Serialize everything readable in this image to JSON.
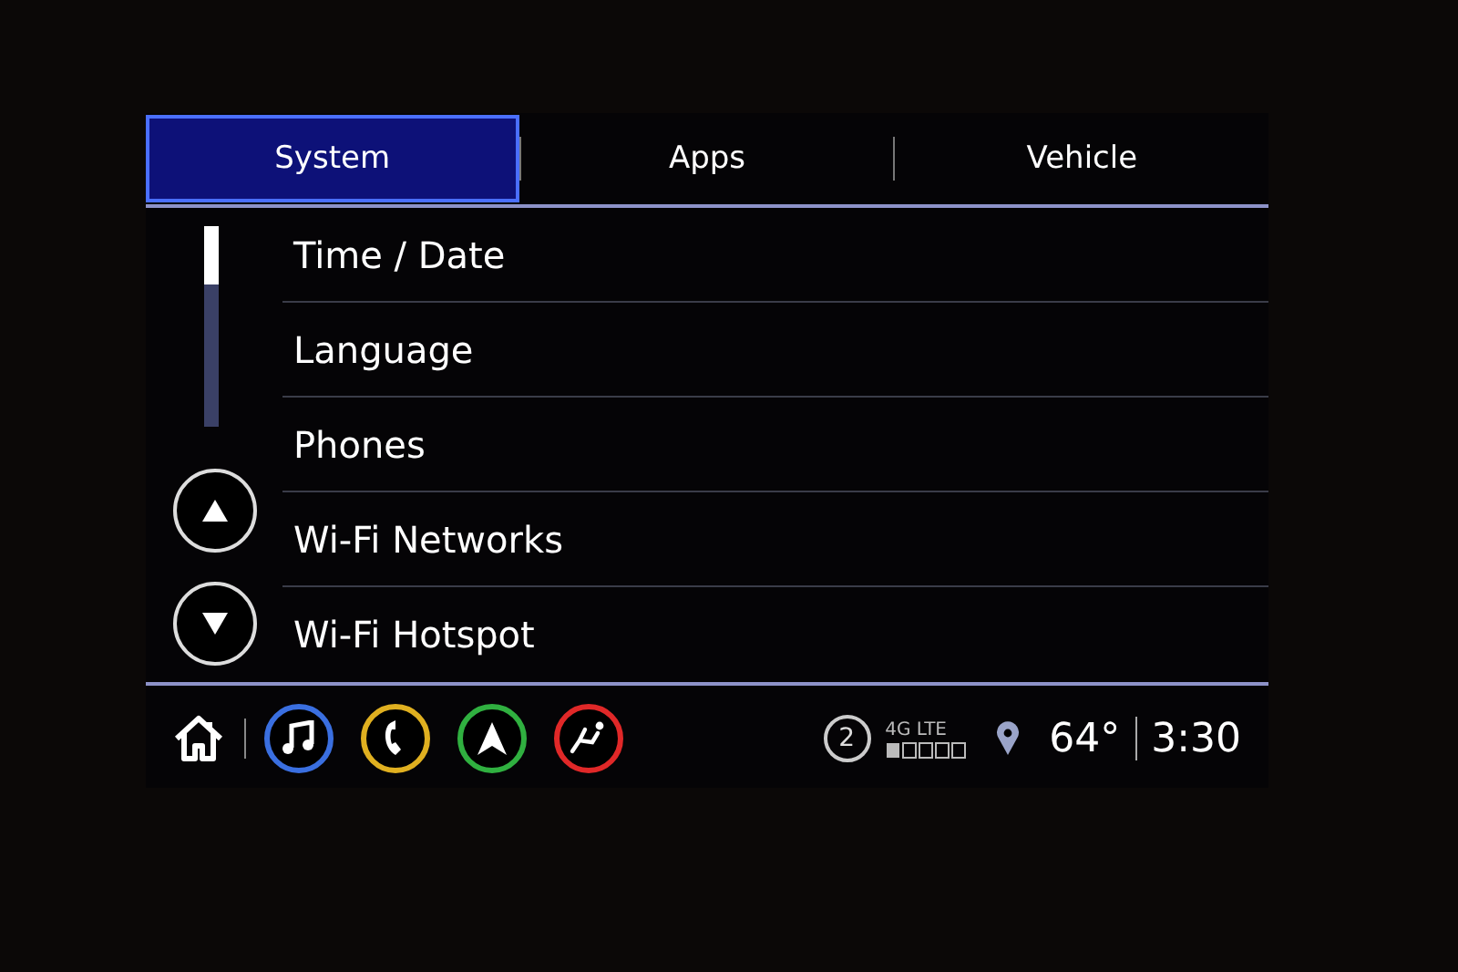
{
  "tabs": [
    {
      "label": "System",
      "selected": true
    },
    {
      "label": "Apps",
      "selected": false
    },
    {
      "label": "Vehicle",
      "selected": false
    }
  ],
  "menu": [
    {
      "label": "Time / Date"
    },
    {
      "label": "Language"
    },
    {
      "label": "Phones"
    },
    {
      "label": "Wi-Fi Networks"
    },
    {
      "label": "Wi-Fi Hotspot"
    }
  ],
  "shortcuts": [
    {
      "kind": "music",
      "color": "#3a6fe0"
    },
    {
      "kind": "phone",
      "color": "#e0b020"
    },
    {
      "kind": "navigation",
      "color": "#30b040"
    },
    {
      "kind": "seat",
      "color": "#e02828"
    }
  ],
  "status_bar": {
    "notifications": "2",
    "network": "4G LTE",
    "temperature": "64°",
    "time": "3:30"
  }
}
